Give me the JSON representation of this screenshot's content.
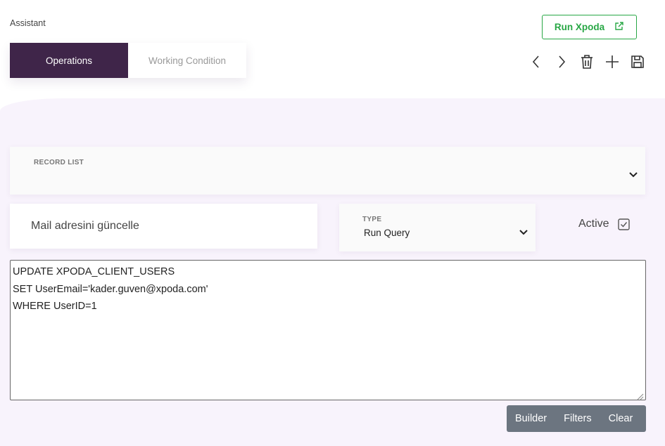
{
  "breadcrumb": "Assistant",
  "header": {
    "run_button_label": "Run Xpoda",
    "run_button_icon": "external-link-icon"
  },
  "tabs": [
    {
      "label": "Operations",
      "active": true
    },
    {
      "label": "Working Condition",
      "active": false
    }
  ],
  "toolbar": {
    "icons": [
      "chevron-left-icon",
      "chevron-right-icon",
      "trash-icon",
      "plus-icon",
      "save-icon"
    ]
  },
  "record_list": {
    "label": "RECORD LIST",
    "value": ""
  },
  "operation": {
    "name_value": "Mail adresini güncelle",
    "type_label": "TYPE",
    "type_value": "Run Query",
    "active_label": "Active",
    "active_checked": true
  },
  "query": {
    "text": "UPDATE XPODA_CLIENT_USERS\nSET UserEmail='kader.guven@xpoda.com'\nWHERE UserID=1"
  },
  "query_buttons": {
    "builder": "Builder",
    "filters": "Filters",
    "clear": "Clear"
  },
  "colors": {
    "tab_active_bg": "#3f2549",
    "run_accent": "#28a745",
    "panel_bg": "#f8f3fc",
    "button_group_bg": "#6c7580"
  }
}
